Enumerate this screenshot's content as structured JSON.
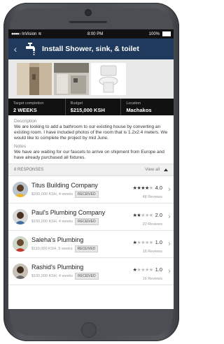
{
  "status_bar": {
    "carrier": "InVision",
    "time": "8:00 PM",
    "battery": "100%"
  },
  "header": {
    "title": "Install Shower, sink, & toilet"
  },
  "photos": [
    "bathroom-photo-1",
    "bathroom-photo-2",
    "toilet-photo"
  ],
  "stats": [
    {
      "label": "Target completion",
      "value": "2 WEEKS"
    },
    {
      "label": "Budget",
      "value": "$215,000 KSH"
    },
    {
      "label": "Location",
      "value": "Machakos"
    }
  ],
  "description": {
    "heading": "Description",
    "text": "We are looking to add a bathroom to our existing house by converting an existing room. I have included photos of the room that is 1.2x2.4 meters. We would like to complete the project by mid June."
  },
  "notes": {
    "heading": "Notes",
    "text": "We have are waiting for our faucets to arrive on shipment from Europe and have already purchased all fixtures."
  },
  "responses": {
    "count_label": "8 RESPONSES",
    "view_all": "View all",
    "items": [
      {
        "name": "Titus Building Company",
        "quote": "$200,000 KSH, 4 weeks",
        "badge": "RECEIVED",
        "stars": 4,
        "rating": "4.0",
        "reviews": "48 Reviews"
      },
      {
        "name": "Paul's Plumbing Company",
        "quote": "$150,000 KSH, 4 weeks",
        "badge": "RECEIVED",
        "stars": 2,
        "rating": "2.0",
        "reviews": "20 Reviews"
      },
      {
        "name": "Saleha's Plumbing",
        "quote": "$110,000 KSH, 5 weeks",
        "badge": "RECEIVED",
        "stars": 1,
        "rating": "1.0",
        "reviews": "18 Reviews"
      },
      {
        "name": "Rashid's Plumbing",
        "quote": "$100,000 KSH, 4 weeks",
        "badge": "RECEIVED",
        "stars": 1,
        "rating": "1.0",
        "reviews": "16 Reviews"
      }
    ]
  },
  "colors": {
    "navbar": "#1f3a5c",
    "stats_bg": "#111111"
  }
}
